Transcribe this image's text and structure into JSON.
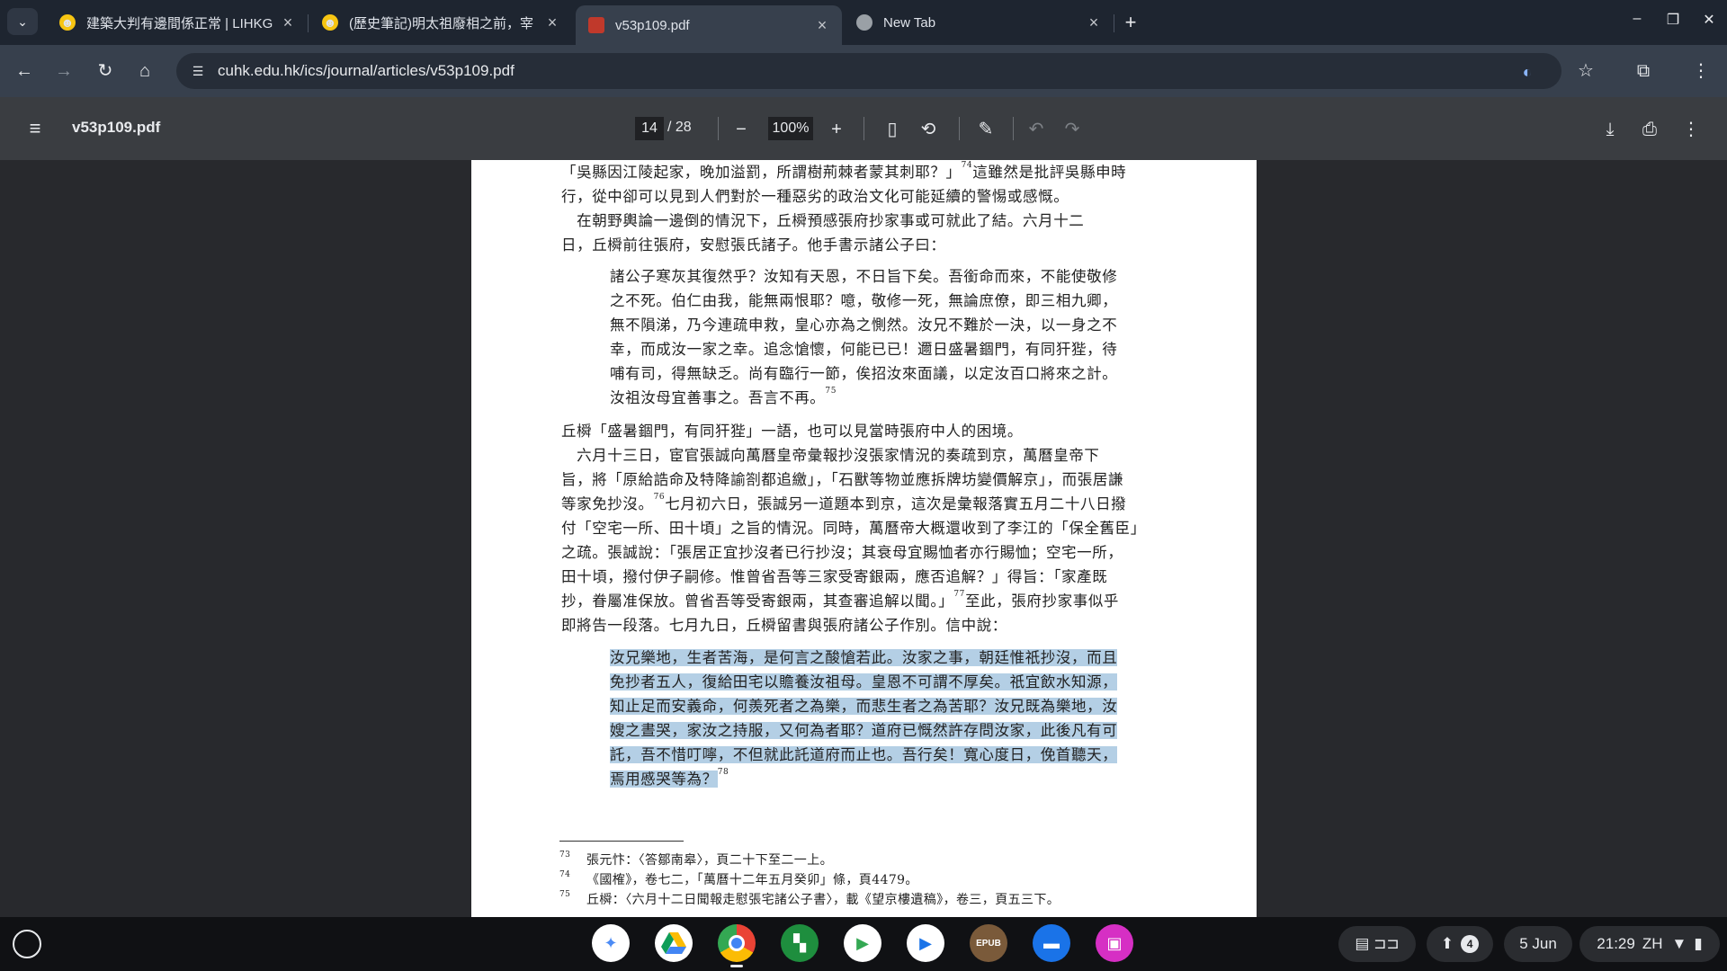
{
  "browser": {
    "tabs": [
      {
        "title": "建築大判有邊間係正常 | LIHKG",
        "icon": "smiley-icon",
        "active": false
      },
      {
        "title": "(歷史筆記)明太祖廢相之前，宰",
        "icon": "smiley-icon",
        "active": false
      },
      {
        "title": "v53p109.pdf",
        "icon": "pdf-icon",
        "active": true
      },
      {
        "title": "New Tab",
        "icon": "chrome-icon",
        "active": false
      }
    ],
    "url": "cuhk.edu.hk/ics/journal/articles/v53p109.pdf"
  },
  "pdf": {
    "title": "v53p109.pdf",
    "page_current": "14",
    "page_total": "/ 28",
    "zoom": "100%"
  },
  "document": {
    "para1": [
      "「吳縣因江陵起家，晚加溢罰，所謂樹荊棘者蒙其刺耶？」",
      "74",
      "這雖然是批評吳縣申時",
      "行，從中卻可以見到人們對於一種惡劣的政治文化可能延續的警惕或感慨。",
      "　在朝野輿論一邊倒的情況下，丘橓預感張府抄家事或可就此了結。六月十二",
      "日，丘橓前往張府，安慰張氏諸子。他手書示諸公子曰："
    ],
    "quote1": [
      "諸公子寒灰其復然乎？汝知有天恩，不日旨下矣。吾銜命而來，不能使敬修",
      "之不死。伯仁由我，能無兩恨耶？噫，敬修一死，無論庶僚，即三相九卿，",
      "無不隕涕，乃今連疏申救，皇心亦為之惻然。汝兄不難於一決，以一身之不",
      "幸，而成汝一家之幸。追念愴懷，何能已已！邇日盛暑錮門，有同犴狴，待",
      "哺有司，得無缺乏。尚有臨行一節，俟招汝來面議，以定汝百口將來之計。",
      "汝祖汝母宜善事之。吾言不再。",
      "75"
    ],
    "para2": [
      "丘橓「盛暑錮門，有同犴狴」一語，也可以見當時張府中人的困境。",
      "　六月十三日，宦官張誠向萬曆皇帝彙報抄沒張家情況的奏疏到京，萬曆皇帝下",
      "旨，將「原給誥命及特降諭劄都追繳」，「石獸等物並應拆牌坊變價解京」，而張居謙",
      "等家免抄沒。",
      "76",
      "七月初六日，張誠另一道題本到京，這次是彙報落實五月二十八日撥",
      "付「空宅一所、田十頃」之旨的情況。同時，萬曆帝大概還收到了李江的「保全舊臣」",
      "之疏。張誠說：「張居正宜抄沒者已行抄沒；其衰母宜賜恤者亦行賜恤；空宅一所，",
      "田十頃，撥付伊子嗣修。惟曾省吾等三家受寄銀兩，應否追解？」得旨：「家產既",
      "抄，眷屬准保放。曾省吾等受寄銀兩，其查審追解以聞。」",
      "77",
      "至此，張府抄家事似乎",
      "即將告一段落。七月九日，丘橓留書與張府諸公子作別。信中說："
    ],
    "quote2": [
      "汝兄樂地，生者苦海，是何言之酸愴若此。汝家之事，朝廷惟祇抄沒，而且",
      "免抄者五人，復給田宅以贍養汝祖母。皇恩不可謂不厚矣。祇宜飲水知源，",
      "知止足而安義命，何羨死者之為樂，而悲生者之為苦耶？汝兄既為樂地，汝",
      "嫂之晝哭，家汝之持服，又何為者耶？道府已慨然許存問汝家，此後凡有可",
      "託，吾不惜叮嚀，不但就此託道府而止也。吾行矣！寬心度日，俛首聽天，",
      "焉用慼哭等為？",
      "78"
    ],
    "footnotes": [
      {
        "num": "73",
        "text": "張元忭：〈答鄒南皋〉，頁二十下至二一上。"
      },
      {
        "num": "74",
        "text": "《國榷》，卷七二，「萬曆十二年五月癸卯」條，頁4479。"
      },
      {
        "num": "75",
        "text": "丘橓：〈六月十二日聞報走慰張宅諸公子書〉，載《望京樓遺稿》，卷三，頁五三下。"
      }
    ]
  },
  "shelf": {
    "date": "5 Jun",
    "time": "21:29",
    "ime": "ZH",
    "notif_count": "4",
    "apps": [
      "gemini-icon",
      "drive-icon",
      "chrome-icon",
      "apps-icon",
      "play-store-icon",
      "play-movies-icon",
      "epub-reader-icon",
      "files-icon",
      "gallery-icon"
    ]
  }
}
